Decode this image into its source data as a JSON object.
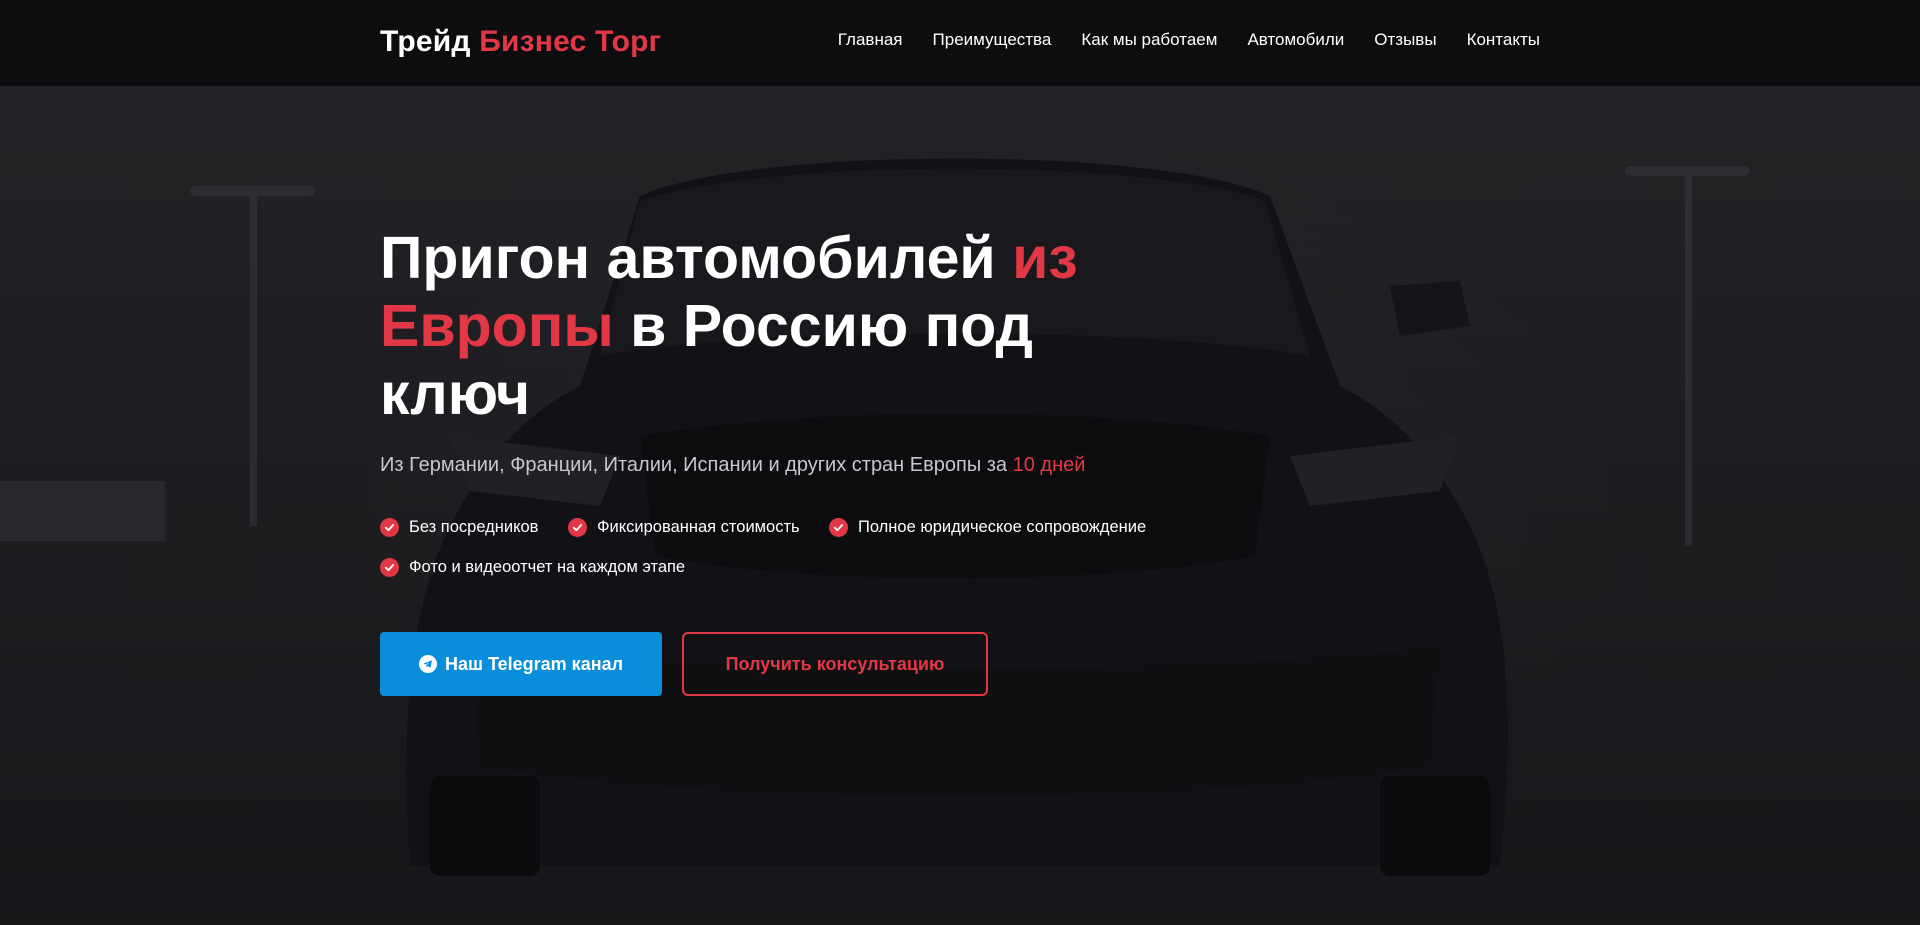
{
  "brand": {
    "part1": "Трейд",
    "part2": "Бизнес Торг",
    "accent_color": "#e23845"
  },
  "nav": {
    "items": [
      {
        "label": "Главная"
      },
      {
        "label": "Преимущества"
      },
      {
        "label": "Как мы работаем"
      },
      {
        "label": "Автомобили"
      },
      {
        "label": "Отзывы"
      },
      {
        "label": "Контакты"
      }
    ]
  },
  "hero": {
    "headline_part1": "Пригон автомобилей",
    "headline_accent": "из Европы",
    "headline_part2": "в Россию под ключ",
    "subtitle_text": "Из Германии, Франции, Италии, Испании и других стран Европы за",
    "subtitle_accent": "10 дней",
    "features": [
      {
        "label": "Без посредников",
        "icon": "check-icon"
      },
      {
        "label": "Фиксированная стоимость",
        "icon": "check-icon"
      },
      {
        "label": "Полное юридическое сопровождение",
        "icon": "check-icon"
      },
      {
        "label": "Фото и видеоотчет на каждом этапе",
        "icon": "check-icon"
      }
    ],
    "telegram_button": {
      "label": "Наш Telegram канал",
      "icon": "telegram-icon",
      "color": "#0a8ddb"
    },
    "consult_button": {
      "label": "Получить консультацию"
    }
  }
}
